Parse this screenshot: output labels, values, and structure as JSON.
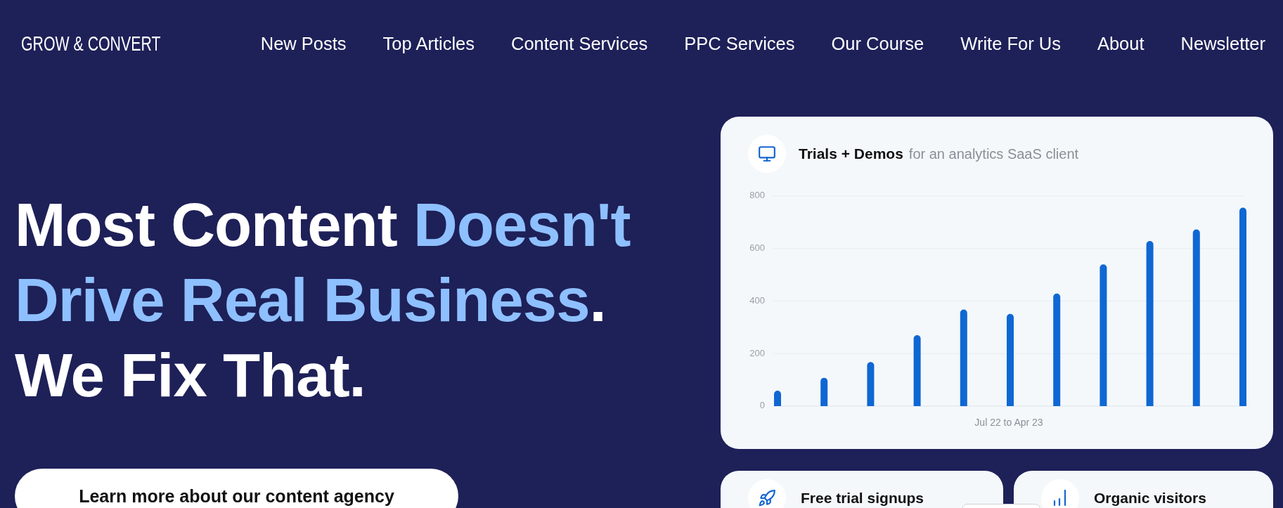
{
  "header": {
    "logo": "GROW & CONVERT",
    "nav": [
      "New Posts",
      "Top Articles",
      "Content Services",
      "PPC Services",
      "Our Course",
      "Write For Us",
      "About",
      "Newsletter"
    ]
  },
  "hero": {
    "headline": [
      {
        "text": "Most Content ",
        "highlight": false
      },
      {
        "text": "Doesn't Drive Real Business",
        "highlight": true
      },
      {
        "text": ". We Fix That.",
        "highlight": false
      }
    ],
    "cta": "Learn more about our content agency"
  },
  "results_card": {
    "title": "Trials + Demos",
    "subtitle": "for an analytics SaaS client",
    "chart_data": {
      "type": "bar",
      "xlabel": "Jul 22 to Apr 23",
      "values": [
        59,
        108,
        168,
        270,
        368,
        351,
        429,
        540,
        629,
        673,
        756
      ],
      "ylim": [
        0,
        800
      ],
      "yticks": [
        0,
        200,
        400,
        600,
        800
      ],
      "grid": true
    }
  },
  "stat_cards": [
    {
      "title": "Free trial signups"
    },
    {
      "title": "Organic visitors"
    }
  ]
}
